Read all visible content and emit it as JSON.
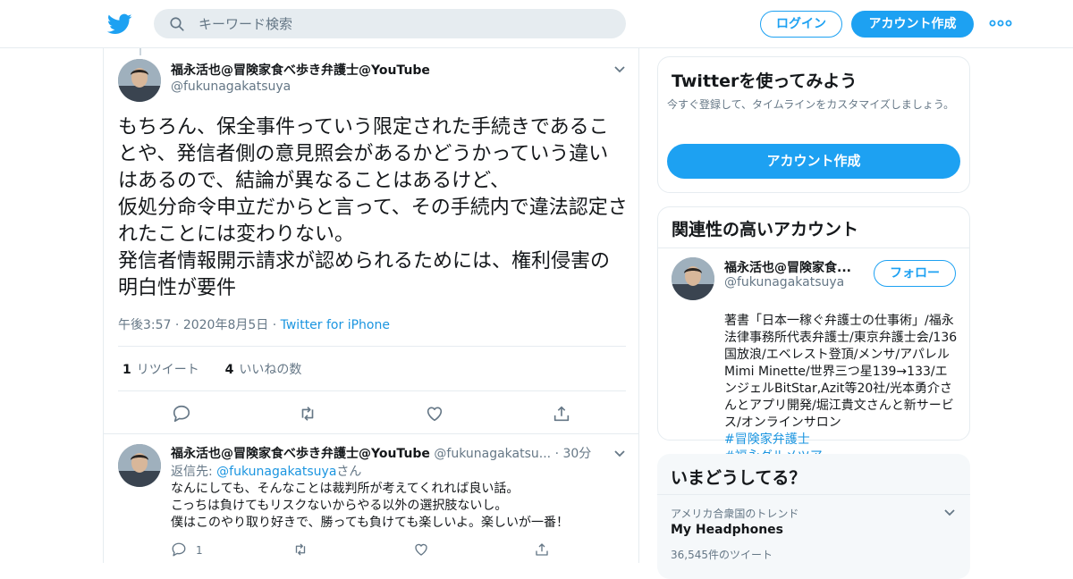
{
  "header": {
    "search_placeholder": "キーワード検索",
    "login_label": "ログイン",
    "signup_label": "アカウント作成",
    "brand_color": "#1da1f2"
  },
  "tweet": {
    "name": "福永活也@冒険家食べ歩き弁護士@YouTube",
    "handle": "@fukunagakatsuya",
    "body": "もちろん、保全事件っていう限定された手続きであることや、発信者側の意見照会があるかどうかっていう違いはあるので、結論が異なることはあるけど、\n仮処分命令申立だからと言って、その手続内で違法認定されたことには変わりない。\n発信者情報開示請求が認められるためには、権利侵害の明白性が要件",
    "time": "午後3:57",
    "date": "2020年8月5日",
    "source": "Twitter for iPhone",
    "retweet_count": "1",
    "retweet_label": "リツイート",
    "like_count": "4",
    "like_label": "いいねの数"
  },
  "reply": {
    "name": "福永活也@冒険家食べ歩き弁護士@YouTube",
    "handle": "@fukunagakatsu...",
    "age": "30分",
    "reply_to_prefix": "返信先:",
    "reply_to_handle": "@fukunagakatsuya",
    "reply_to_suffix": "さん",
    "body": "なんにしても、そんなことは裁判所が考えてくれれば良い話。\nこっちは負けてもリスクないからやる以外の選択肢ないし。\n僕はこのやり取り好きで、勝っても負けても楽しいよ。楽しいが一番！",
    "reply_count": "1"
  },
  "sidebar": {
    "signup_card": {
      "title": "Twitterを使ってみよう",
      "subtitle": "今すぐ登録して、タイムラインをカスタマイズしましょう。",
      "button_label": "アカウント作成"
    },
    "related_card": {
      "title": "関連性の高いアカウント",
      "name": "福永活也@冒険家食...",
      "handle": "@fukunagakatsuya",
      "follow_label": "フォロー",
      "bio": "著書「日本一稼ぐ弁護士の仕事術」/福永法律事務所代表弁護士/東京弁護士会/136国放浪/エベレスト登頂/メンサ/アパレルMimi Minette/世界三つ星139→133/エンジェルBitStar,Azit等20社/光本勇介さんとアプリ開発/堀江貴文さんと新サービス/オンラインサロン",
      "hashtags": [
        "#冒険家弁護士",
        "#福永グルメツアー"
      ]
    },
    "trends_card": {
      "title": "いまどうしてる？",
      "context": "アメリカ合衆国のトレンド",
      "topic": "My Headphones",
      "count": "36,545件のツイート"
    }
  }
}
